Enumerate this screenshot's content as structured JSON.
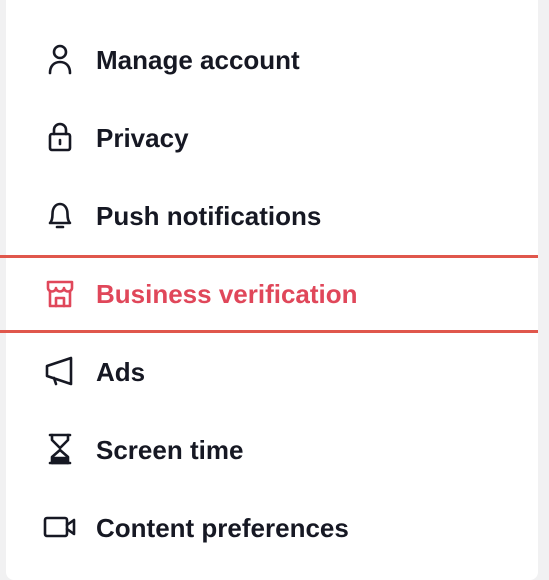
{
  "menu": {
    "items": [
      {
        "label": "Manage account",
        "icon": "person-icon",
        "active": false
      },
      {
        "label": "Privacy",
        "icon": "lock-icon",
        "active": false
      },
      {
        "label": "Push notifications",
        "icon": "bell-icon",
        "active": false
      },
      {
        "label": "Business verification",
        "icon": "storefront-icon",
        "active": true
      },
      {
        "label": "Ads",
        "icon": "megaphone-icon",
        "active": false
      },
      {
        "label": "Screen time",
        "icon": "hourglass-icon",
        "active": false
      },
      {
        "label": "Content preferences",
        "icon": "video-camera-icon",
        "active": false
      }
    ]
  },
  "colors": {
    "text": "#161823",
    "active_text": "#e0475a",
    "active_border": "#e0574c",
    "background": "#ffffff"
  }
}
